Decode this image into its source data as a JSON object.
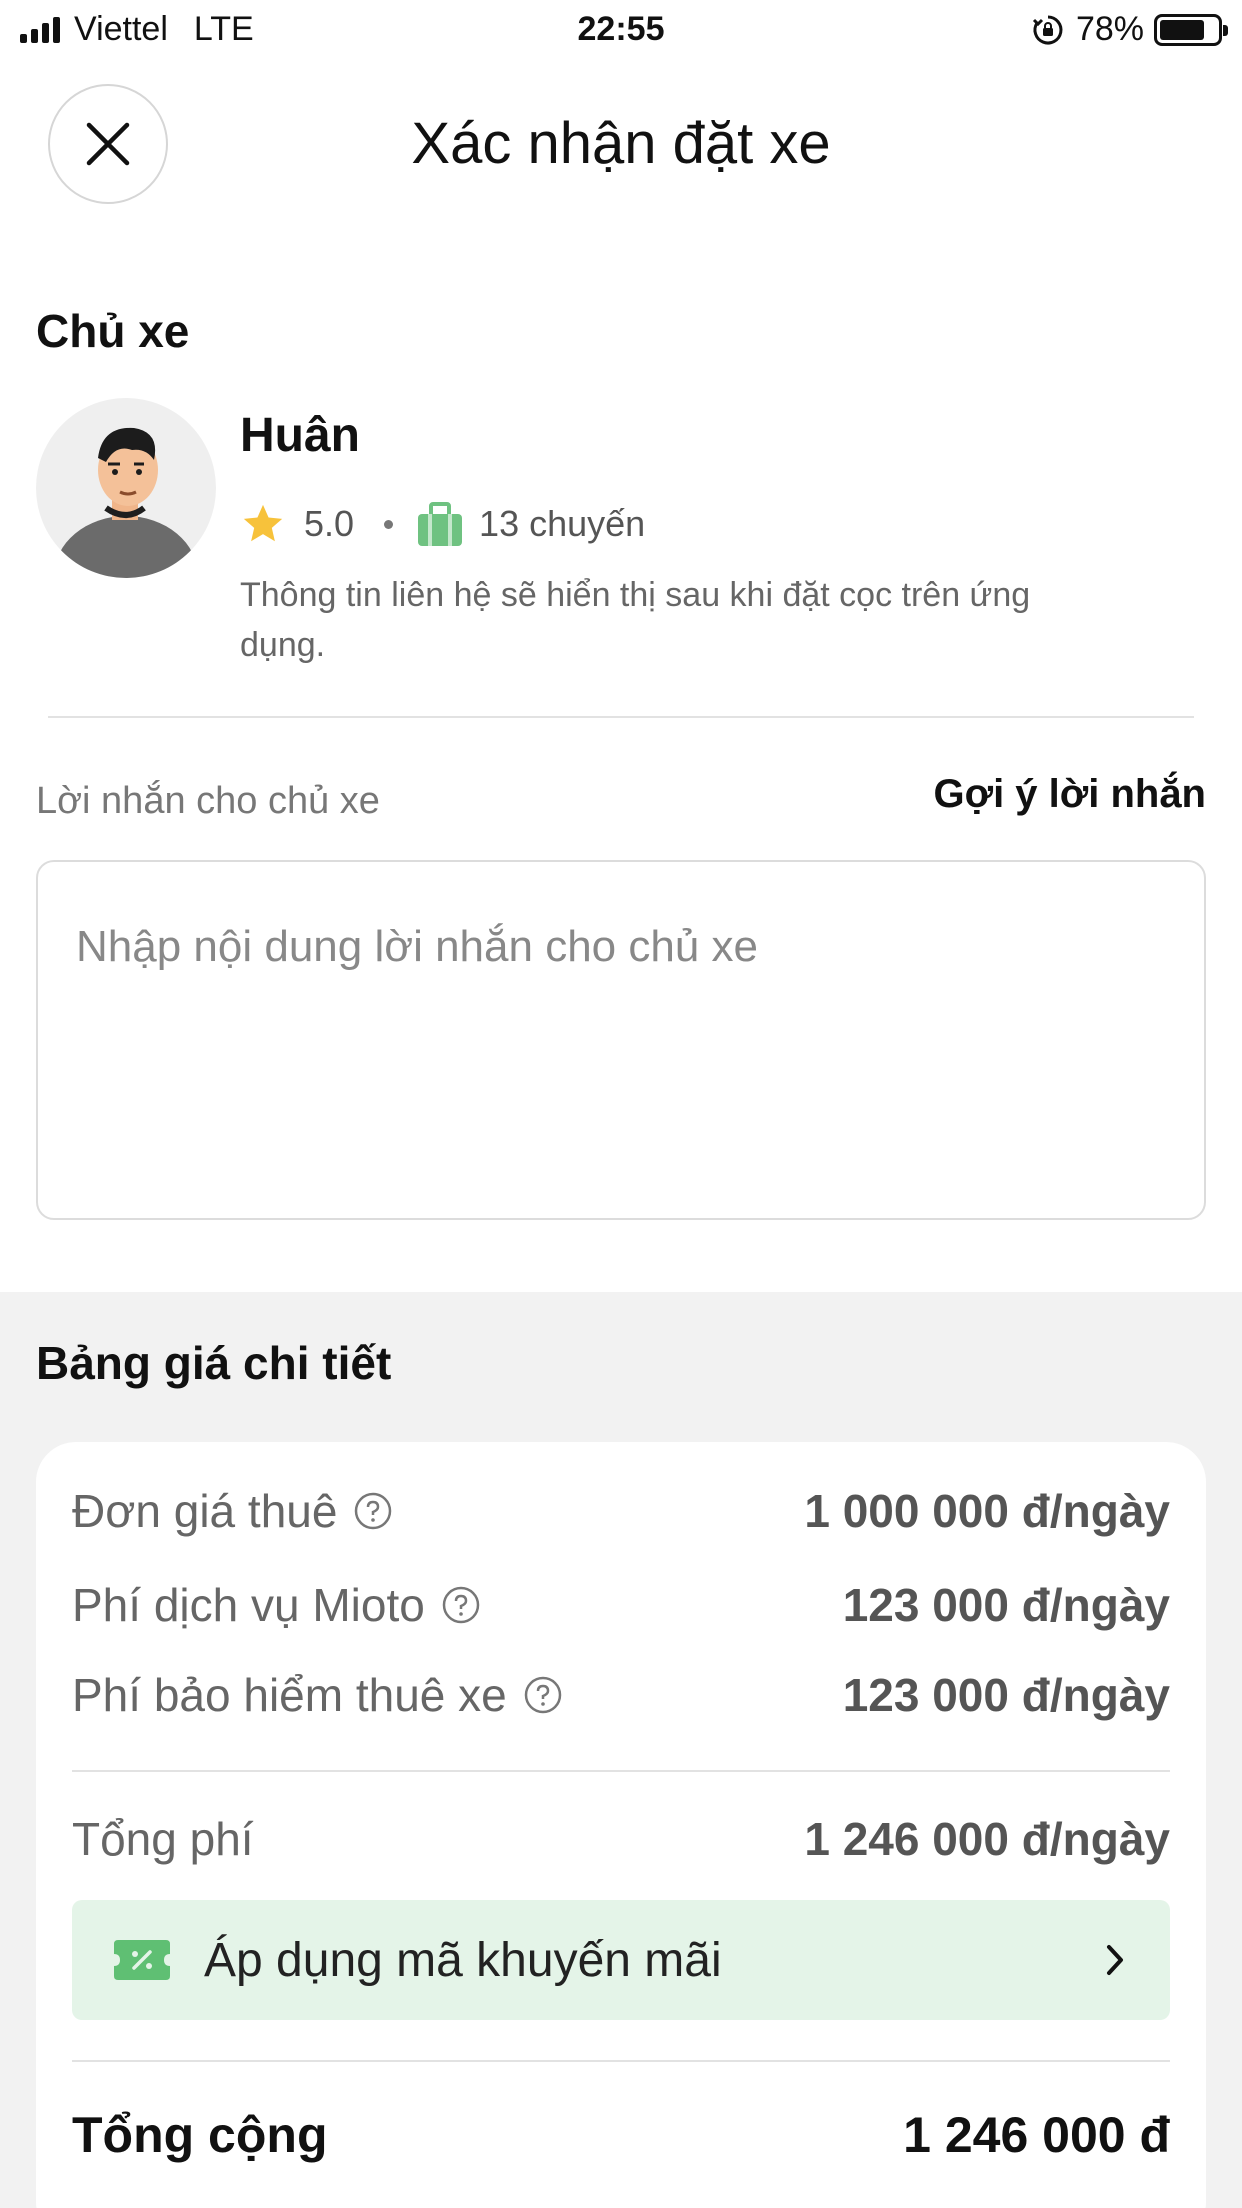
{
  "status_bar": {
    "carrier": "Viettel",
    "network": "LTE",
    "time": "22:55",
    "battery": "78%",
    "battery_level": 0.78
  },
  "header": {
    "title": "Xác nhận đặt xe",
    "close_icon": "close-icon"
  },
  "owner": {
    "section_title": "Chủ xe",
    "name": "Huân",
    "rating": "5.0",
    "trips": "13 chuyến",
    "note": "Thông tin liên hệ sẽ hiển thị sau khi đặt cọc trên ứng dụng."
  },
  "message": {
    "label": "Lời nhắn cho chủ xe",
    "suggest_label": "Gợi ý lời nhắn",
    "placeholder": "Nhập nội dung lời nhắn cho chủ xe"
  },
  "pricing": {
    "section_title": "Bảng giá chi tiết",
    "rows": [
      {
        "label": "Đơn giá thuê",
        "value": "1 000 000 đ/ngày"
      },
      {
        "label": "Phí dịch vụ Mioto",
        "value": "123 000 đ/ngày"
      },
      {
        "label": "Phí bảo hiểm thuê xe",
        "value": "123 000 đ/ngày"
      }
    ],
    "total_fee": {
      "label": "Tổng phí",
      "value": "1 246 000 đ/ngày"
    },
    "promo_label": "Áp dụng mã khuyến mãi",
    "grand_total": {
      "label": "Tổng cộng",
      "value": "1 246 000 đ"
    }
  },
  "colors": {
    "promo_bg": "#e4f4e8",
    "accent_green": "#5fbf73",
    "star": "#f7c23b",
    "section_bg": "#f2f2f2"
  }
}
